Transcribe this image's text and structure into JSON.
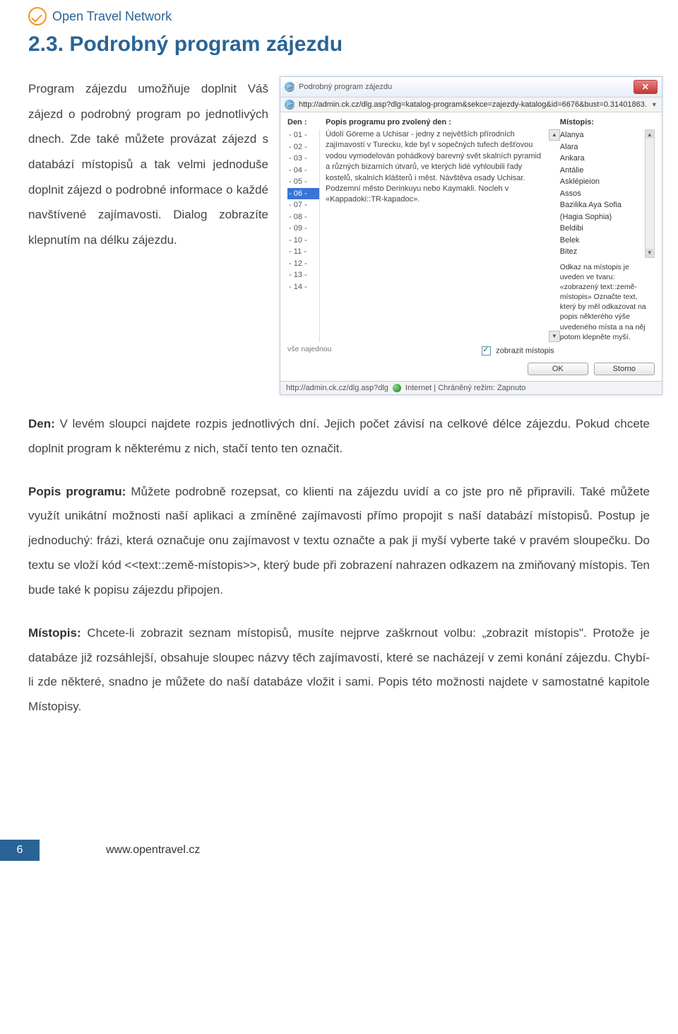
{
  "brand": "Open Travel Network",
  "section_title": "2.3. Podrobný program zájezdu",
  "intro": "Program zájezdu umožňuje doplnit Váš zájezd o podrobný program po jednotlivých dnech. Zde také můžete provázat zájezd s databází místopisů a tak velmi jednoduše doplnit zájezd o podrobné informace o každé navštívené zajímavosti. Dialog zobrazíte klepnutím na délku zájezdu.",
  "dialog": {
    "title": "Podrobný program zájezdu",
    "url": "http://admin.ck.cz/dlg.asp?dlg=katalog-program&sekce=zajezdy-katalog&id=6676&bust=0.31401863.",
    "header_den": "Den :",
    "header_popis": "Popis programu pro zvolený den :",
    "header_mistopis": "Místopis:",
    "days": [
      "- 01 -",
      "- 02 -",
      "- 03 -",
      "- 04 -",
      "- 05 -",
      "- 06 -",
      "- 07 -",
      "- 08 -",
      "- 09 -",
      "- 10 -",
      "- 11 -",
      "- 12 -",
      "- 13 -",
      "- 14 -"
    ],
    "selected_day_index": 5,
    "all_at_once": "vše najednou",
    "popis_text": "Údolí Göreme a Uchisar - jedny z největších přírodních zajímavostí v Turecku, kde byl v sopečných tufech dešťovou vodou vymodelován pohádkový barevný svět skalních pyramid a různých bizarních útvarů, ve kterých lidé vyhloubili řady kostelů, skalních klášterů i měst. Návštěva osady Uchisar. Podzemní město Derinkuyu nebo Kaymakli. Nocleh v «Kappadoki::TR-kapadoc».",
    "mistopis_items": [
      "Alanya",
      "Alara",
      "Ankara",
      "Antálie",
      "Asklépieion",
      "Assos",
      "Bazilika Aya Sofia (Hagia Sophia)",
      "Beldibi",
      "Belek",
      "Bitez"
    ],
    "mistopis_hint": "Odkaz na místopis je uveden ve tvaru: «zobrazený text::země-místopis» Označte text, který by měl odkazovat na popis některého výše uvedeného místa a na něj potom klepněte myší.",
    "checkbox_label": "zobrazit místopis",
    "ok": "OK",
    "storno": "Storno",
    "status_url": "http://admin.ck.cz/dlg.asp?dlg",
    "status_mode": "Internet | Chráněný režim: Zapnuto"
  },
  "para_den": "Den: V levém sloupci najdete rozpis jednotlivých dní. Jejich počet závisí na celkové délce zájezdu. Pokud chcete doplnit program k některému z nich, stačí tento ten označit.",
  "para_den_bold": "Den:",
  "para_popis": "Popis programu:  Můžete podrobně rozepsat, co klienti na zájezdu uvidí a co jste pro ně připravili. Také můžete využít unikátní možnosti naší aplikaci a zmíněné zajímavosti přímo propojit s naší databází místopisů. Postup je jednoduchý: frázi, která označuje onu zajímavost v textu označte a pak ji myší vyberte také v pravém sloupečku. Do textu se vloží kód <<text::země-místopis>>, který bude při zobrazení nahrazen odkazem na zmiňovaný místopis. Ten bude také k popisu zájezdu připojen.",
  "para_popis_bold": "Popis programu:",
  "para_mistopis": "Místopis: Chcete-li zobrazit seznam místopisů, musíte nejprve zaškrnout volbu: „zobrazit místopis\". Protože je databáze již rozsáhlejší, obsahuje sloupec  názvy těch zajímavostí, které se nacházejí v zemi konání zájezdu. Chybí-li zde některé, snadno je můžete do naší databáze vložit i sami. Popis této možnosti najdete v samostatné kapitole Místopisy.",
  "para_mistopis_bold": "Místopis:",
  "footer": {
    "page": "6",
    "url": "www.opentravel.cz"
  }
}
